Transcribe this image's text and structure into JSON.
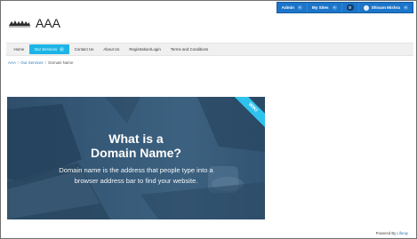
{
  "dockbar": {
    "admin_label": "Admin",
    "my_sites_label": "My Sites",
    "notification_count": "0",
    "user_name": "Shivam Mishra"
  },
  "header": {
    "site_title": "AAA",
    "logo_icon": "mountain-logo-icon"
  },
  "nav": {
    "items": [
      {
        "label": "Home"
      },
      {
        "label": "Our Services"
      },
      {
        "label": "Contact Us"
      },
      {
        "label": "About Us"
      },
      {
        "label": "Registration/Login"
      },
      {
        "label": "Terms and Conditions"
      }
    ],
    "active_index": 1
  },
  "breadcrumb": {
    "items": [
      "AAA",
      "Our Services",
      "Domain Name"
    ],
    "separator": "/"
  },
  "banner": {
    "title_line1": "What is a",
    "title_line2": "Domain Name?",
    "subtitle_line1": "Domain name is the address that people type into a",
    "subtitle_line2": "browser address bar to find your website.",
    "ribbon": "WIKI"
  },
  "footer": {
    "prefix": "Powered By",
    "link": "Liferay"
  },
  "colors": {
    "dockbar": "#1c75c9",
    "nav_active": "#1cb5e6",
    "ribbon": "#2ec3ee",
    "banner": "#355a78"
  }
}
